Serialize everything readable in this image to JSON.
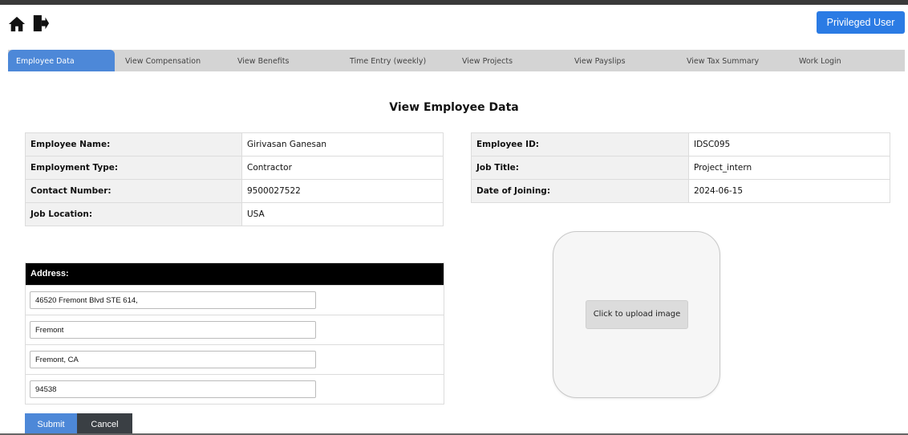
{
  "header": {
    "home_icon": "home-icon",
    "logout_icon": "exit-door-icon",
    "privileged_label": "Privileged User",
    "accent_color": "#2b7be4"
  },
  "tabs": [
    {
      "label": "Employee Data",
      "active": true
    },
    {
      "label": "View Compensation",
      "active": false
    },
    {
      "label": "View Benefits",
      "active": false
    },
    {
      "label": "Time Entry (weekly)",
      "active": false
    },
    {
      "label": "View Projects",
      "active": false
    },
    {
      "label": "View Payslips",
      "active": false
    },
    {
      "label": "View Tax Summary",
      "active": false
    },
    {
      "label": "Work Login",
      "active": false
    }
  ],
  "page": {
    "title": "View Employee Data"
  },
  "left_info": [
    {
      "label": "Employee Name:",
      "value": "Girivasan Ganesan"
    },
    {
      "label": "Employment Type:",
      "value": "Contractor"
    },
    {
      "label": "Contact Number:",
      "value": "9500027522"
    },
    {
      "label": "Job Location:",
      "value": "USA"
    }
  ],
  "right_info": [
    {
      "label": "Employee ID:",
      "value": "IDSC095"
    },
    {
      "label": "Job Title:",
      "value": "Project_intern"
    },
    {
      "label": "Date of Joining:",
      "value": "2024-06-15"
    }
  ],
  "address": {
    "header": "Address:",
    "lines": [
      "46520 Fremont Blvd STE 614,",
      "Fremont",
      "Fremont, CA",
      "94538"
    ]
  },
  "upload": {
    "label": "Click to upload image"
  },
  "actions": {
    "submit": "Submit",
    "cancel": "Cancel"
  }
}
